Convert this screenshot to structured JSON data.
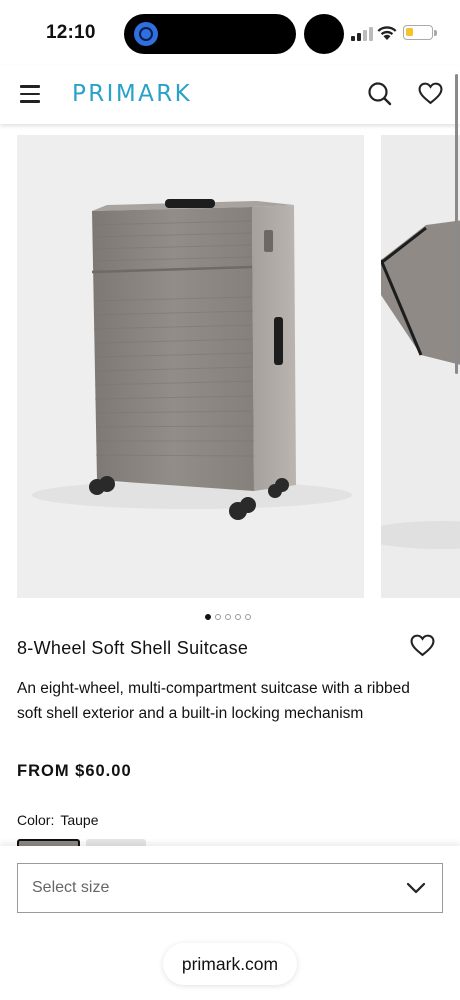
{
  "status_bar": {
    "time": "12:10"
  },
  "header": {
    "logo": "PRIMARK"
  },
  "gallery": {
    "slide_count": 5,
    "active_slide": 1
  },
  "product": {
    "title": "8-Wheel Soft Shell Suitcase",
    "description": "An eight-wheel, multi-compartment suitcase with a ribbed soft shell exterior and a built-in locking mechanism",
    "price": "FROM $60.00",
    "color_label": "Color:",
    "color_value": "Taupe"
  },
  "size_selector": {
    "placeholder": "Select size"
  },
  "browser": {
    "url": "primark.com"
  },
  "colors": {
    "brand": "#2aa1c9",
    "suitcase": "#8c8782",
    "background": "#ffffff",
    "image_bg": "#eeeeee"
  },
  "icons": {
    "menu": "hamburger-icon",
    "search": "search-icon",
    "wishlist": "heart-icon",
    "dropdown": "chevron-down-icon"
  }
}
